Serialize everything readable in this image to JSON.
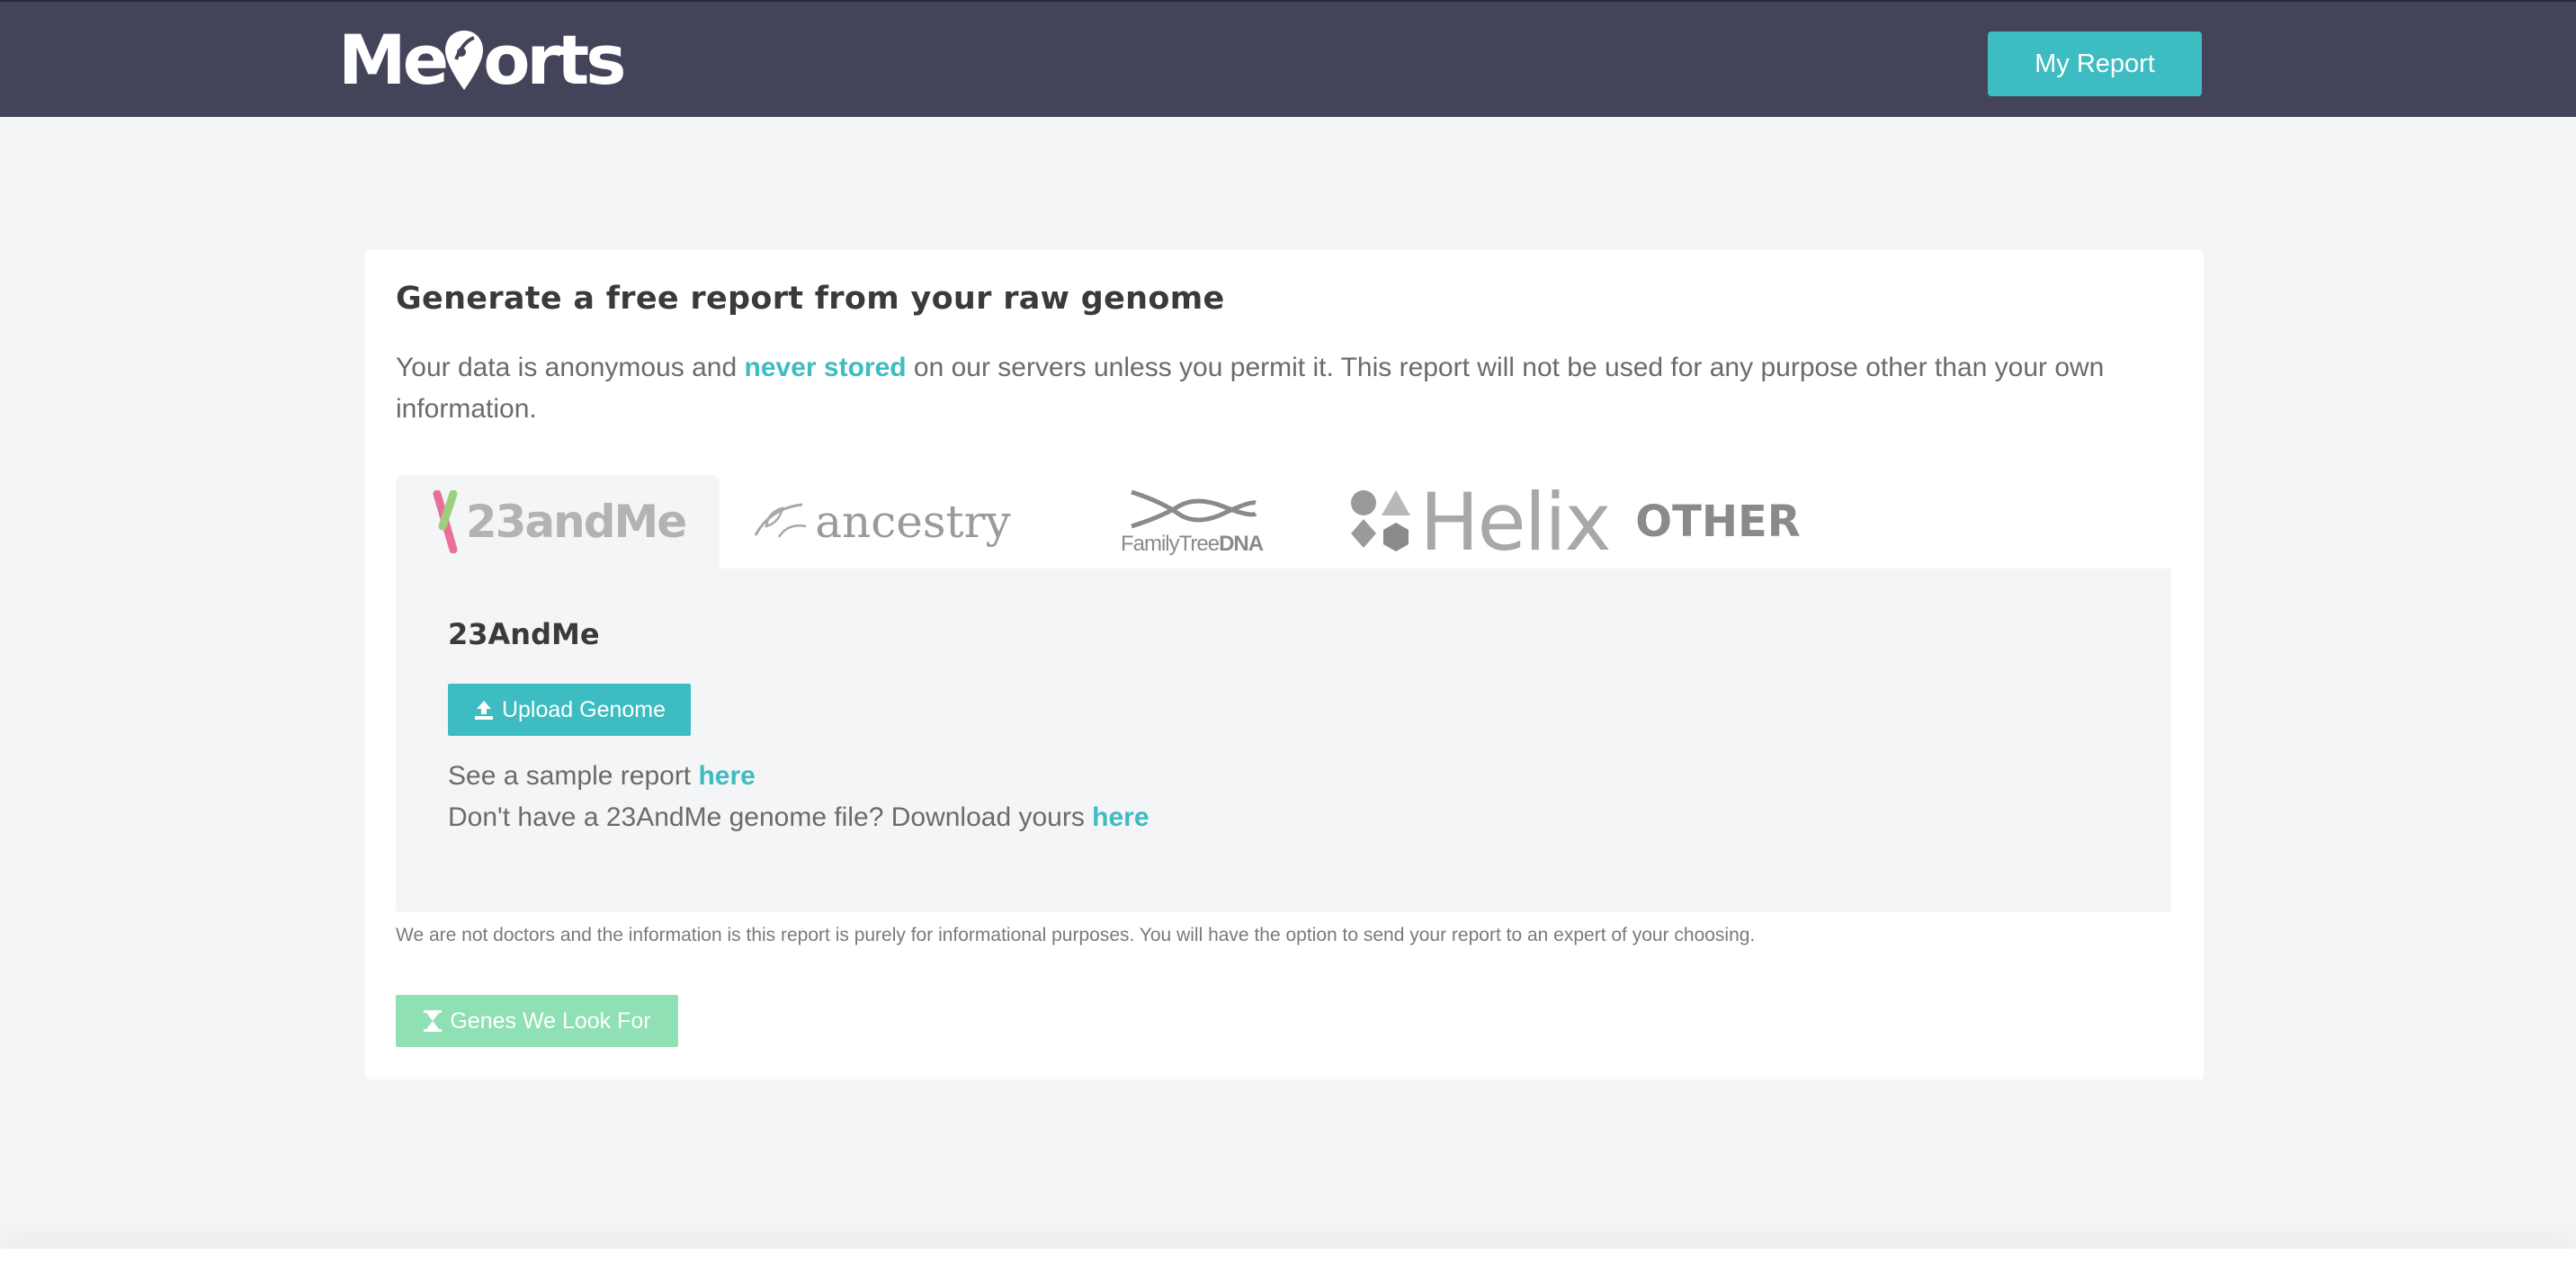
{
  "header": {
    "logo_text_before": "Me",
    "logo_text_after": "orts",
    "logo_text": "Meports",
    "my_report_label": "My Report"
  },
  "card": {
    "title": "Generate a free report from your raw genome",
    "intro_before": "Your data is anonymous and ",
    "intro_accent": "never stored",
    "intro_after": " on our servers unless you permit it. This report will not be used for any purpose other than your own information."
  },
  "tabs": [
    {
      "label": "23andMe",
      "active": true,
      "icon": "chromosome-icon"
    },
    {
      "label": "ancestry",
      "active": false,
      "icon": "leaf-icon"
    },
    {
      "label_main": "FamilyTree",
      "label_bold": "DNA",
      "active": false,
      "icon": "dna-helix-icon"
    },
    {
      "label": "Helix",
      "active": false,
      "icon": "shapes-icon"
    },
    {
      "label": "OTHER",
      "active": false
    }
  ],
  "panel": {
    "title": "23AndMe",
    "upload_label": "Upload Genome",
    "sample_text": "See a sample report ",
    "sample_link": "here",
    "download_text": "Don't have a 23AndMe genome file? Download yours ",
    "download_link": "here"
  },
  "disclaimer": "We are not doctors and the information is this report is purely for informational purposes. You will have the option to send your report to an expert of your choosing.",
  "genes_button_label": "Genes We Look For",
  "colors": {
    "header_bg": "#434459",
    "accent": "#3dbcc2",
    "genes_button": "#8fe0b4",
    "page_bg": "#f4f5f7"
  }
}
